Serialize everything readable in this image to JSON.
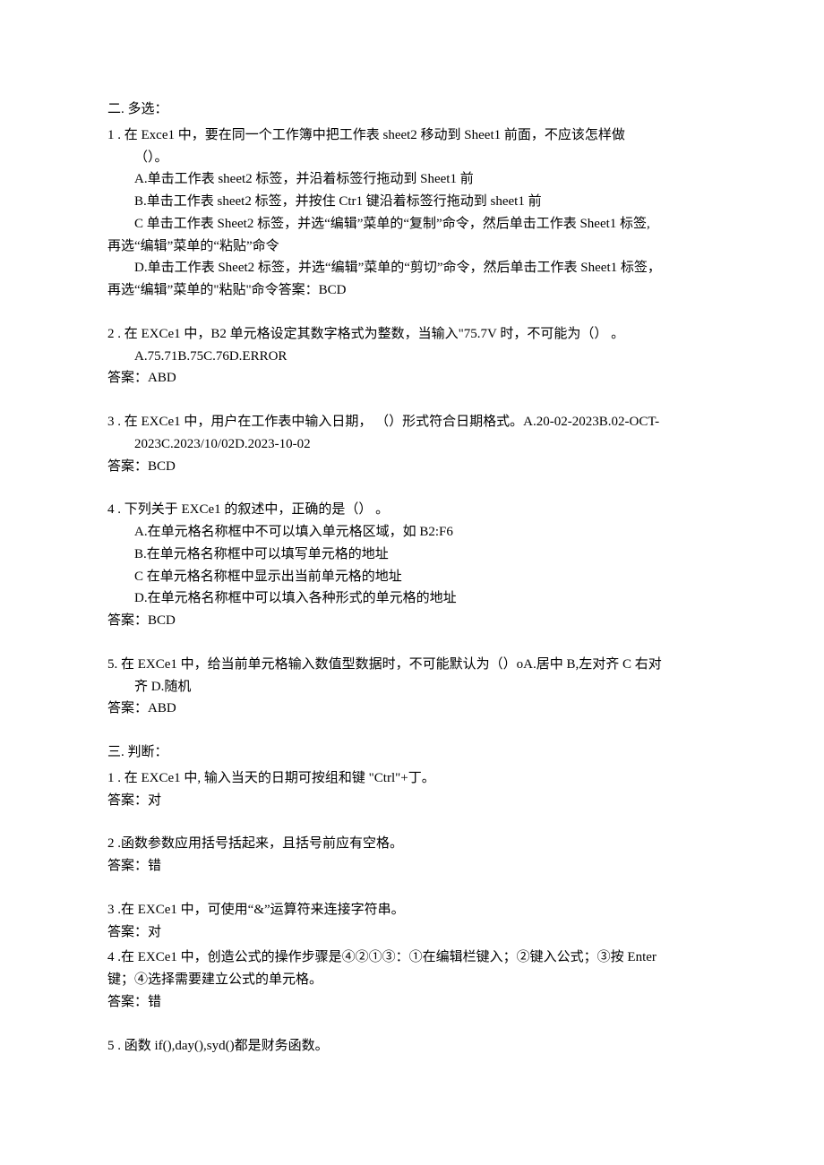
{
  "section2_header": "二. 多选：",
  "s2q1": {
    "l1": "1 . 在 Exce1 中，要在同一个工作簿中把工作表 sheet2 移动到 Sheet1 前面，不应该怎样做",
    "l2": "（）。",
    "a": "A.单击工作表 sheet2 标签，并沿着标签行拖动到 Sheet1 前",
    "b": "B.单击工作表 sheet2 标签，并按住 Ctr1 键沿着标签行拖动到 sheet1 前",
    "c": "C 单击工作表 Sheet2 标签，并选“编辑”菜单的“复制”命令，然后单击工作表 Sheet1 标签,",
    "c2": "再选“编辑”菜单的“粘贴”命令",
    "d": "D.单击工作表 Sheet2 标签，并选“编辑”菜单的“剪切”命令，然后单击工作表 Sheet1 标签，",
    "d2": "再选“编辑”菜单的\"粘贴\"命令答案：BCD"
  },
  "s2q2": {
    "l1": "2  . 在 EXCe1 中，B2 单元格设定其数字格式为整数，当输入\"75.7V 时，不可能为（） 。",
    "opts": "A.75.71B.75C.76D.ERROR",
    "ans": "答案：ABD"
  },
  "s2q3": {
    "l1": "3 . 在 EXCe1 中，用户在工作表中输入日期， （）形式符合日期格式。A.20-02-2023B.02-OCT-",
    "l2": "2023C.2023/10/02D.2023-10-02",
    "ans": "答案：BCD"
  },
  "s2q4": {
    "l1": "4  . 下列关于 EXCe1 的叙述中，正确的是（） 。",
    "a": "A.在单元格名称框中不可以填入单元格区域，如 B2:F6",
    "b": "B.在单元格名称框中可以填写单元格的地址",
    "c": "C 在单元格名称框中显示出当前单元格的地址",
    "d": "D.在单元格名称框中可以填入各种形式的单元格的地址",
    "ans": "答案：BCD"
  },
  "s2q5": {
    "l1": "5. 在 EXCe1 中，给当前单元格输入数值型数据时，不可能默认为（）oA.居中 B,左对齐 C 右对",
    "l2": "齐 D.随机",
    "ans": "答案：ABD"
  },
  "section3_header": "三. 判断：",
  "s3q1": {
    "l1": "1  . 在 EXCe1 中, 输入当天的日期可按组和键 \"Ctrl\"+丁。",
    "ans": "答案：对"
  },
  "s3q2": {
    "l1": "2   .函数参数应用括号括起来，且括号前应有空格。",
    "ans": "答案：错"
  },
  "s3q3": {
    "l1": "3   .在 EXCe1 中，可使用“&”运算符来连接字符串。",
    "ans": "答案：对"
  },
  "s3q4": {
    "l1": "4   .在 EXCe1 中，创造公式的操作步骤是④②①③：①在编辑栏键入；②键入公式；③按 Enter",
    "l2": "键；④选择需要建立公式的单元格。",
    "ans": "答案：错"
  },
  "s3q5": {
    "l1": "5  . 函数 if(),day(),syd()都是财务函数。"
  }
}
